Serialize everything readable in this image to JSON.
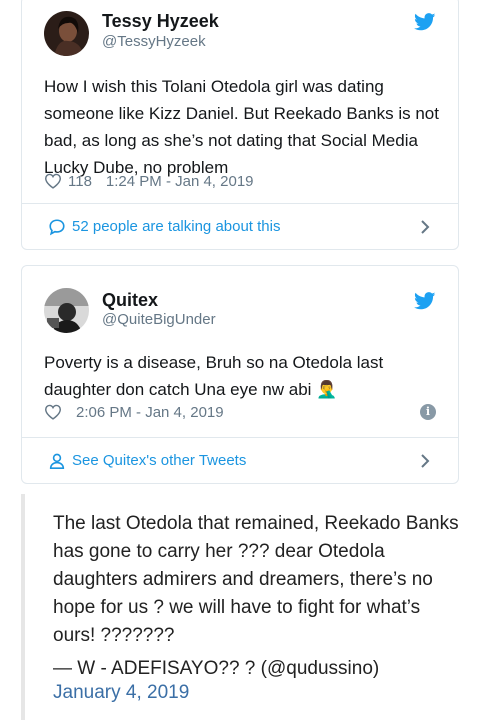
{
  "tweet1": {
    "display_name": "Tessy Hyzeek",
    "handle": "@TessyHyzeek",
    "text": "How I wish this Tolani Otedola girl was dating someone like Kizz Daniel. But Reekado Banks is not bad, as long as she’s not dating that Social Media Lucky Dube, no problem",
    "like_count": "118",
    "timestamp": "1:24 PM - Jan 4, 2019",
    "footer_text": "52 people are talking about this",
    "icons": {
      "bird": "twitter-bird-icon",
      "heart": "heart-icon",
      "footer": "speech-bubble-icon",
      "chevron": "chevron-right-icon"
    }
  },
  "tweet2": {
    "display_name": "Quitex",
    "handle": "@QuiteBigUnder",
    "text": "Poverty is a disease, Bruh so na Otedola last daughter don catch Una eye nw abi 🤦‍♂️",
    "timestamp": "2:06 PM - Jan 4, 2019",
    "footer_text": "See Quitex's other Tweets",
    "icons": {
      "bird": "twitter-bird-icon",
      "heart": "heart-icon",
      "info": "info-icon",
      "footer": "person-icon",
      "chevron": "chevron-right-icon"
    }
  },
  "quote": {
    "text": "The last Otedola that remained, Reekado Banks has gone to carry her ??? dear Otedola daughters admirers and dreamers, there’s no hope for us ? we will have to fight for what’s ours! ???????",
    "attribution": "— W - ADEFISAYO?? ? (@qudussino)",
    "date": "January 4, 2019"
  },
  "colors": {
    "link": "#1b95e0",
    "muted": "#657786",
    "border": "#e1e8ed",
    "quote_date": "#3b6fa6"
  }
}
